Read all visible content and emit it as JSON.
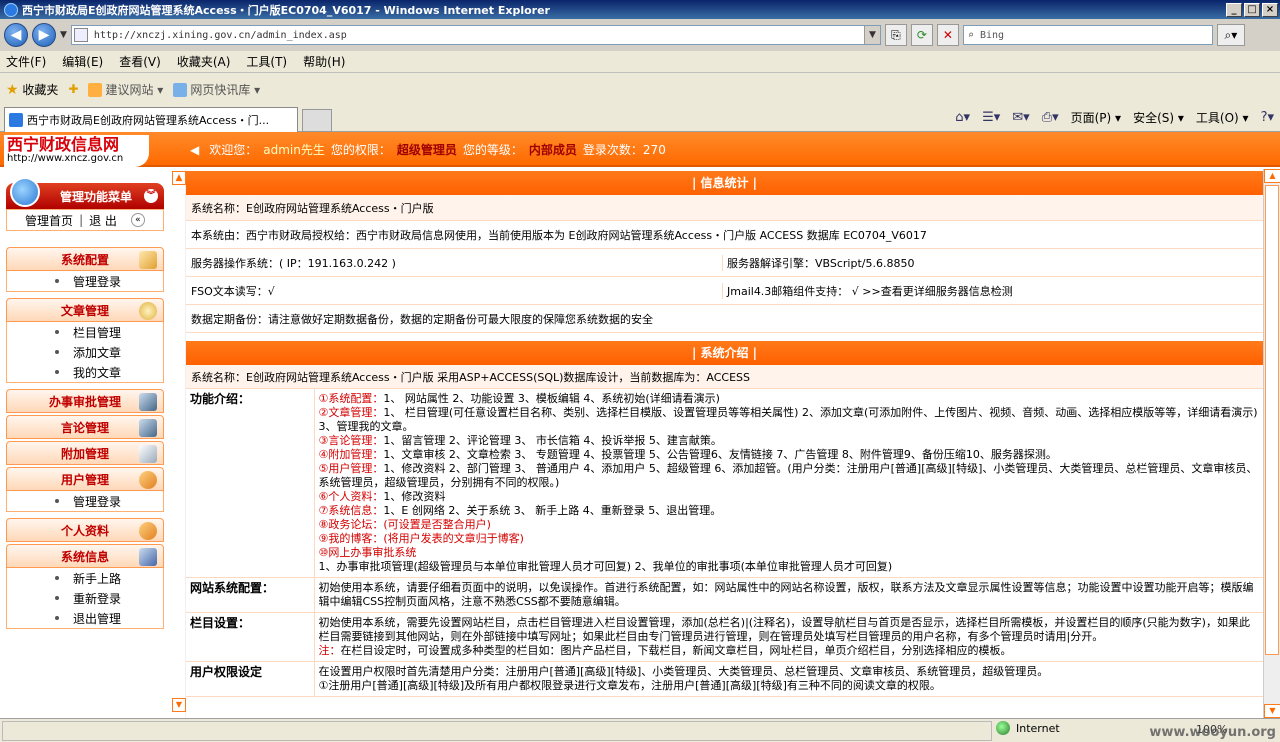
{
  "window": {
    "title": "西宁市财政局E创政府网站管理系统Access・门户版EC0704_V6017 - Windows Internet Explorer"
  },
  "address": {
    "url": "http://xnczj.xining.gov.cn/admin_index.asp",
    "search_placeholder": "Bing"
  },
  "menubar": [
    "文件(F)",
    "编辑(E)",
    "查看(V)",
    "收藏夹(A)",
    "工具(T)",
    "帮助(H)"
  ],
  "favbar": {
    "favorites": "收藏夹",
    "suggest": "建议网站",
    "slice": "网页快讯库"
  },
  "tab": {
    "title": "西宁市财政局E创政府网站管理系统Access・门..."
  },
  "cmdbar": {
    "page": "页面(P)",
    "safety": "安全(S)",
    "tools": "工具(O)"
  },
  "site": {
    "logo_cn": "西宁财政信息网",
    "logo_url": "http://www.xncz.gov.cn",
    "welcome_label": "欢迎您：",
    "user": "admin先生",
    "rights_label": "您的权限：",
    "rights": "超级管理员",
    "level_label": "您的等级：",
    "level": "内部成员",
    "login_label": "登录次数：270"
  },
  "sidebar": {
    "header": "管理功能菜单",
    "home": "管理首页",
    "sep": "|",
    "logout": "退 出",
    "sections": [
      {
        "title": "系统配置",
        "items": [
          "管理登录"
        ]
      },
      {
        "title": "文章管理",
        "items": [
          "栏目管理",
          "添加文章",
          "我的文章"
        ]
      },
      {
        "title": "办事审批管理",
        "items": []
      },
      {
        "title": "言论管理",
        "items": []
      },
      {
        "title": "附加管理",
        "items": []
      },
      {
        "title": "用户管理",
        "items": [
          "管理登录"
        ]
      },
      {
        "title": "个人资料",
        "items": []
      },
      {
        "title": "系统信息",
        "items": [
          "新手上路",
          "重新登录",
          "退出管理"
        ]
      }
    ]
  },
  "info": {
    "bar": "| 信息统计 |",
    "sys_name": "系统名称：E创政府网站管理系统Access・门户版",
    "usage": "本系统由：西宁市财政局授权给：西宁市财政局信息网使用，当前使用版本为 E创政府网站管理系统Access・门户版   ACCESS 数据库 EC0704_V6017",
    "server_os": "服务器操作系统：( IP：191.163.0.242 )",
    "server_engine": "服务器解译引擎：VBScript/5.6.8850",
    "fso": "FSO文本读写：√",
    "jmail": "Jmail4.3邮箱组件支持：  √  >>查看更详细服务器信息检测",
    "backup": "数据定期备份：请注意做好定期数据备份，数据的定期备份可最大限度的保障您系统数据的安全"
  },
  "intro": {
    "bar": "| 系统介绍 |",
    "sys_name": "系统名称：E创政府网站管理系统Access・门户版 采用ASP+ACCESS(SQL)数据库设计，当前数据库为：ACCESS",
    "func_label": "功能介绍：",
    "func_lines": [
      {
        "head": "①系统配置：",
        "text": "1、 网站属性 2、功能设置 3、模板编辑 4、系统初始(详细请看演示)",
        "tail": ""
      },
      {
        "head": "②文章管理：",
        "text": "1、 栏目管理(可任意设置栏目名称、类别、选择栏目模版、设置管理员等等相关属性) 2、添加文章(可添加附件、上传图片、视频、音频、动画、选择相应模版等等，详细请看演示) 3、管理我的文章。",
        "tail": ""
      },
      {
        "head": "③言论管理：",
        "text": "1、留言管理 2、评论管理 3、 市长信箱 4、投诉举报 5、建言献策。",
        "tail": ""
      },
      {
        "head": "④附加管理：",
        "text": "1、文章审核 2、文章检索 3、 专题管理 4、投票管理 5、公告管理6、友情链接 7、广告管理 8、附件管理9、备份压缩10、服务器探测。",
        "tail": ""
      },
      {
        "head": "⑤用户管理：",
        "text": "1、修改资料 2、部门管理 3、 普通用户 4、添加用户 5、超级管理 6、添加超管。(用户分类：注册用户[普通][高级][特级]、小类管理员、大类管理员、总栏管理员、文章审核员、系统管理员，超级管理员，分别拥有不同的权限。)",
        "tail": ""
      },
      {
        "head": "⑥个人资料：",
        "text": "1、修改资料",
        "tail": ""
      },
      {
        "head": "⑦系统信息：",
        "text": "1、E 创网络 2、关于系统 3、 新手上路 4、重新登录 5、退出管理。",
        "tail": ""
      },
      {
        "head": "⑧政务论坛：",
        "text": "",
        "tail": "(可设置是否整合用户)"
      },
      {
        "head": "⑨我的博客：",
        "text": "",
        "tail": "(将用户发表的文章归于博客)"
      },
      {
        "head": "⑩网上办事审批系统",
        "text": "",
        "tail": ""
      }
    ],
    "func_last": "1、办事审批项管理(超级管理员与本单位审批管理人员才可回复) 2、我单位的审批事项(本单位审批管理人员才可回复)",
    "site_label": "网站系统配置：",
    "site_text": "初始使用本系统，请要仔细看页面中的说明，以免误操作。首进行系统配置，如：网站属性中的网站名称设置，版权，联系方法及文章显示属性设置等信息；功能设置中设置功能开启等；模版编辑中编辑CSS控制页面风格，注意不熟悉CSS都不要随意编辑。",
    "col_label": "栏目设置：",
    "col_text": "初始使用本系统，需要先设置网站栏目，点击栏目管理进入栏目设置管理，添加(总栏名)|(注释名)，设置导航栏目与首页是否显示，选择栏目所需模板，并设置栏目的顺序(只能为数字)，如果此栏目需要链接到其他网站，则在外部链接中填写网址；如果此栏目由专门管理员进行管理，则在管理员处填写栏目管理员的用户名称，有多个管理员时请用|分开。",
    "col_note_head": "注：",
    "col_note": "在栏目设定时，可设置成多种类型的栏目如：图片产品栏目，下载栏目，新闻文章栏目，网址栏目，单页介绍栏目，分别选择相应的模板。",
    "perm_label": "用户权限设定",
    "perm_text1": "在设置用户权限时首先清楚用户分类：注册用户[普通][高级][特级]、小类管理员、大类管理员、总栏管理员、文章审核员、系统管理员，超级管理员。",
    "perm_text2": "①注册用户[普通][高级][特级]及所有用户都权限登录进行文章发布，注册用户[普通][高级][特级]有三种不同的阅读文章的权限。"
  },
  "status": {
    "zone": "Internet",
    "zoom": "100%",
    "watermark": "www.wooyun.org"
  }
}
